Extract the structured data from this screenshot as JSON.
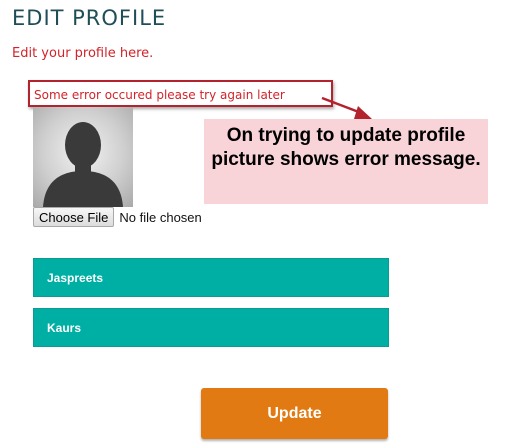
{
  "header": {
    "title": "EDIT PROFILE",
    "subtitle": "Edit your profile here."
  },
  "error": {
    "message": "Some error occured please try again later"
  },
  "annotation": {
    "text": "On trying to update profile picture shows error message."
  },
  "profile_picture": {
    "icon": "avatar-silhouette-icon"
  },
  "file_input": {
    "button_label": "Choose File",
    "status": "No file chosen"
  },
  "form": {
    "first_name": "Jaspreets",
    "last_name": "Kaurs",
    "submit_label": "Update"
  },
  "colors": {
    "title": "#1f4e57",
    "error_text": "#d2232a",
    "field_bg": "#00afa4",
    "button_bg": "#e17a12",
    "callout_bg": "#f8d3d8"
  }
}
